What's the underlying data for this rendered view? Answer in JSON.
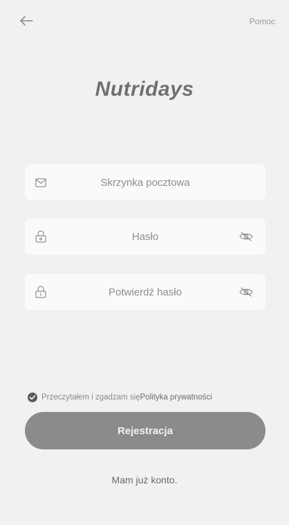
{
  "header": {
    "back_icon": "arrow-left-icon",
    "help_label": "Pomoc"
  },
  "app": {
    "title": "Nutridays"
  },
  "form": {
    "email": {
      "placeholder": "Skrzynka pocztowa",
      "icon": "mail-icon"
    },
    "password": {
      "placeholder": "Hasło",
      "icon": "lock-icon",
      "toggle_icon": "eye-hidden-icon"
    },
    "confirm_password": {
      "placeholder": "Potwierdź hasło",
      "icon": "lock-icon",
      "toggle_icon": "eye-hidden-icon"
    }
  },
  "consent": {
    "text": "Przeczytałem i zgadzam się ",
    "link": "Polityka prywatności",
    "checked": true
  },
  "actions": {
    "register_label": "Rejestracja",
    "login_label": "Mam już konto."
  },
  "colors": {
    "background": "#f1f1f1",
    "field_background": "#fafafa",
    "button": "#8b8b8b",
    "title": "#707070"
  }
}
